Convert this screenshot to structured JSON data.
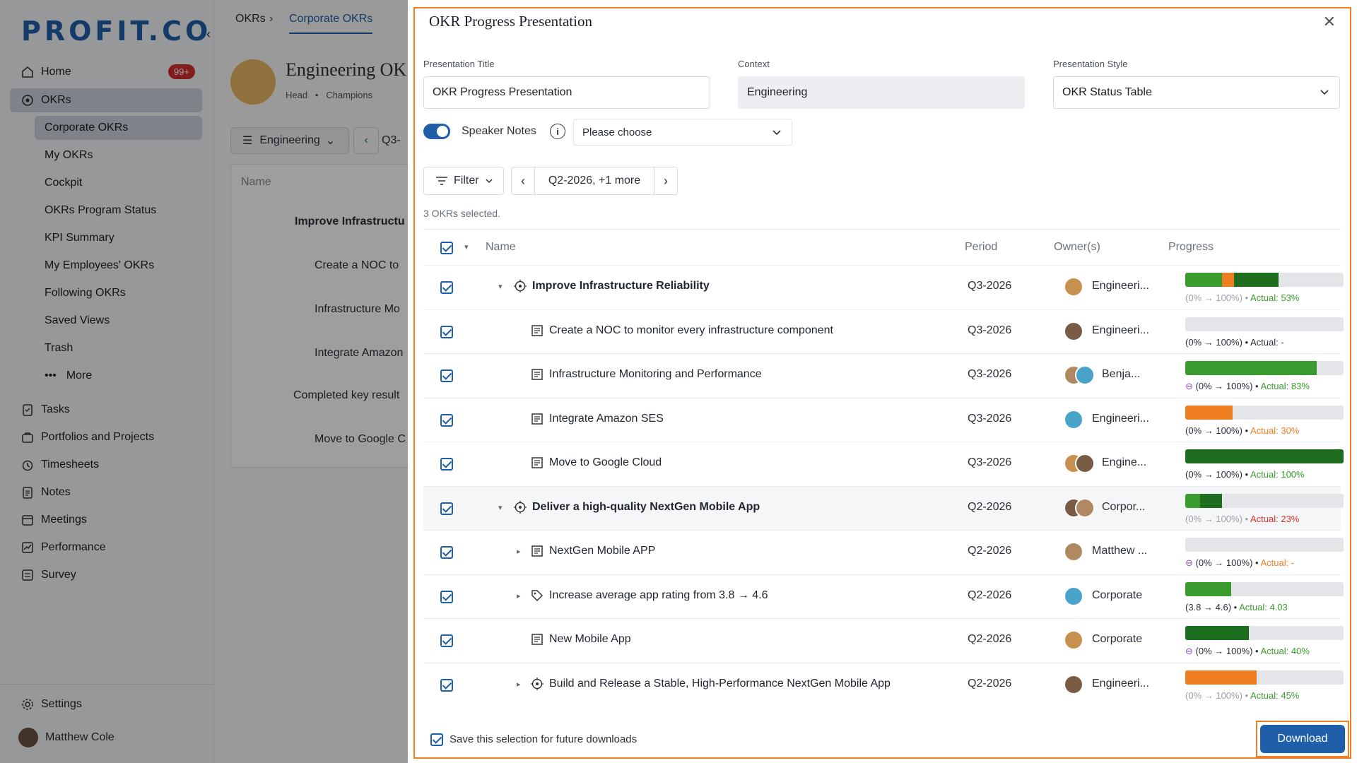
{
  "app": {
    "logo": "PROFIT.CO",
    "nav": [
      {
        "label": "Home",
        "icon": "home-icon",
        "badge": "99+"
      },
      {
        "label": "OKRs",
        "icon": "target-icon",
        "active": true
      }
    ],
    "okr_subnav": [
      "Corporate OKRs",
      "My OKRs",
      "Cockpit",
      "OKRs Program Status",
      "KPI Summary",
      "My Employees' OKRs",
      "Following OKRs",
      "Saved Views",
      "Trash",
      "More"
    ],
    "nav_bottom": [
      {
        "label": "Tasks",
        "icon": "tasks-icon"
      },
      {
        "label": "Portfolios and Projects",
        "icon": "portfolio-icon"
      },
      {
        "label": "Timesheets",
        "icon": "timesheet-icon"
      },
      {
        "label": "Notes",
        "icon": "notes-icon"
      },
      {
        "label": "Meetings",
        "icon": "calendar-icon"
      },
      {
        "label": "Performance",
        "icon": "performance-icon"
      },
      {
        "label": "Survey",
        "icon": "survey-icon"
      }
    ],
    "settings": "Settings",
    "user": "Matthew Cole",
    "breadcrumb": [
      "OKRs",
      "Corporate OKRs"
    ],
    "page_title": "Engineering OK",
    "subline": {
      "head": "Head",
      "champions": "Champions"
    },
    "team_filter": "Engineering",
    "period_short": "Q3-",
    "name_col": "Name",
    "bg_rows": [
      "Improve Infrastructu",
      "Create a NOC to",
      "Infrastructure Mo",
      "Integrate Amazon",
      "Completed key result",
      "Move to Google C"
    ]
  },
  "dialog": {
    "title": "OKR Progress Presentation",
    "fields": {
      "title_label": "Presentation Title",
      "title_value": "OKR Progress Presentation",
      "context_label": "Context",
      "context_value": "Engineering",
      "style_label": "Presentation Style",
      "style_value": "OKR Status Table"
    },
    "speaker_notes_label": "Speaker Notes",
    "speaker_notes_on": true,
    "notes_placeholder": "Please choose",
    "filter_label": "Filter",
    "period_label": "Q2-2026, +1 more",
    "selection_count": "3 OKRs selected.",
    "columns": {
      "name": "Name",
      "period": "Period",
      "owners": "Owner(s)",
      "progress": "Progress"
    },
    "rows": [
      {
        "name": "Improve Infrastructure Reliability",
        "type": "objective",
        "period": "Q3-2026",
        "owner": "Engineeri...",
        "progress_range": "(0% → 100%)",
        "actual_label": "Actual: 53%",
        "actual": 0.53
      },
      {
        "name": "Create a NOC to monitor every infrastructure component",
        "type": "key-result",
        "period": "Q3-2026",
        "owner": "Engineeri...",
        "progress_range": "(0% → 100%)",
        "actual_label": "Actual: -",
        "actual": null
      },
      {
        "name": "Infrastructure Monitoring and Performance",
        "type": "key-result",
        "period": "Q3-2026",
        "owner": "Benja...",
        "progress_range": "(0% → 100%)",
        "actual_label": "Actual: 83%",
        "actual": 0.83
      },
      {
        "name": "Integrate Amazon SES",
        "type": "key-result",
        "period": "Q3-2026",
        "owner": "Engineeri...",
        "progress_range": "(0% → 100%)",
        "actual_label": "Actual: 30%",
        "actual": 0.3
      },
      {
        "name": "Move to Google Cloud",
        "type": "key-result",
        "period": "Q3-2026",
        "owner": "Engine...",
        "progress_range": "(0% → 100%)",
        "actual_label": "Actual: 100%",
        "actual": 1.0
      },
      {
        "name": "Deliver a high-quality NextGen Mobile App",
        "type": "objective",
        "period": "Q2-2026",
        "owner": "Corpor...",
        "progress_range": "(0% → 100%)",
        "actual_label": "Actual: 23%",
        "actual": 0.23
      },
      {
        "name": "NextGen Mobile APP",
        "type": "key-result",
        "period": "Q2-2026",
        "owner": "Matthew ...",
        "progress_range": "(0% → 100%)",
        "actual_label": "Actual: -",
        "actual": null
      },
      {
        "name": "Increase average app rating from 3.8 → 4.6",
        "type": "metric",
        "period": "Q2-2026",
        "owner": "Corporate",
        "progress_range": "(3.8 → 4.6)",
        "actual_label": "Actual: 4.03",
        "actual": 0.29
      },
      {
        "name": "New Mobile App",
        "type": "key-result",
        "period": "Q2-2026",
        "owner": "Corporate",
        "progress_range": "(0% → 100%)",
        "actual_label": "Actual: 40%",
        "actual": 0.4
      },
      {
        "name": "Build and Release a Stable, High-Performance NextGen Mobile App",
        "type": "objective",
        "period": "Q2-2026",
        "owner": "Engineeri...",
        "progress_range": "(0% → 100%)",
        "actual_label": "Actual: 45%",
        "actual": 0.45
      }
    ],
    "save_selection_label": "Save this selection for future downloads",
    "download_label": "Download"
  },
  "colors": {
    "primary": "#1f5ea8",
    "highlight": "#f07f23",
    "green": "#3a9b2e",
    "dark_green": "#1f6e1f",
    "orange": "#f07f23",
    "red": "#d6302d",
    "badge_red": "#d42e2e"
  }
}
